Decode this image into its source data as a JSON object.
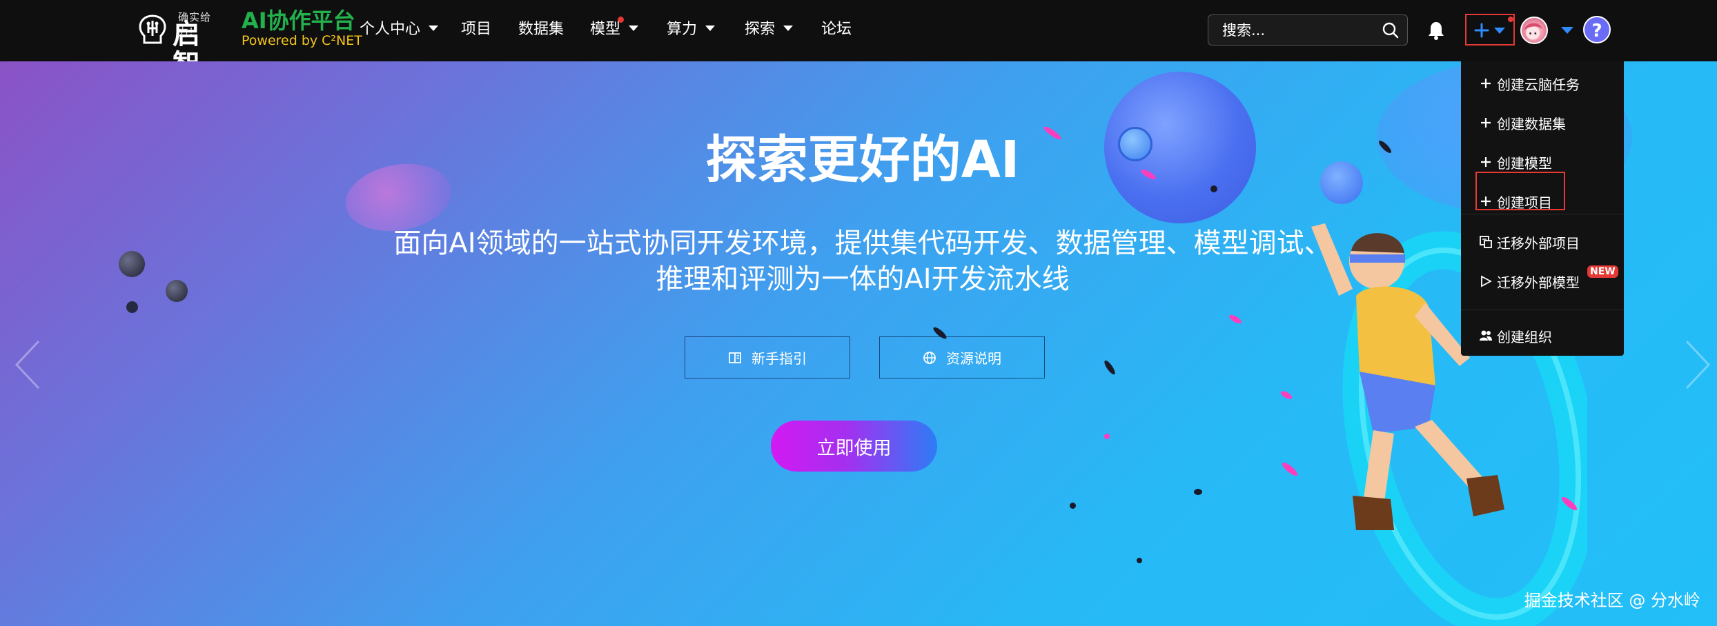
{
  "logo": {
    "tagline": "确实给力!",
    "name": "启智"
  },
  "brand": {
    "title": "AI协作平台",
    "subtitle": "Powered by C²NET"
  },
  "nav": {
    "personal": "个人中心",
    "projects": "项目",
    "datasets": "数据集",
    "models": "模型",
    "compute": "算力",
    "explore": "探索",
    "forum": "论坛"
  },
  "search": {
    "placeholder": "搜索..."
  },
  "dropdown": {
    "items": [
      {
        "label": "创建云脑任务",
        "icon": "plus-icon"
      },
      {
        "label": "创建数据集",
        "icon": "plus-icon"
      },
      {
        "label": "创建模型",
        "icon": "plus-icon"
      },
      {
        "label": "创建项目",
        "icon": "plus-icon"
      },
      {
        "label": "迁移外部项目",
        "icon": "migrate-icon"
      },
      {
        "label": "迁移外部模型",
        "icon": "play-icon"
      },
      {
        "label": "创建组织",
        "icon": "users-icon"
      }
    ],
    "new_badge": "NEW"
  },
  "hero": {
    "title": "探索更好的AI",
    "subtitle": "面向AI领域的一站式协同开发环境，提供集代码开发、数据管理、模型调试、推理和评测为一体的AI开发流水线",
    "guide_button": "新手指引",
    "resource_button": "资源说明",
    "cta": "立即使用"
  },
  "watermark": "掘金技术社区 @ 分水岭",
  "colors": {
    "nav_bg": "#0f0f0f",
    "brand_green": "#22b14c",
    "brand_yellow": "#f5c518",
    "accent_blue": "#2f8cff",
    "highlight_red": "#e53935"
  }
}
